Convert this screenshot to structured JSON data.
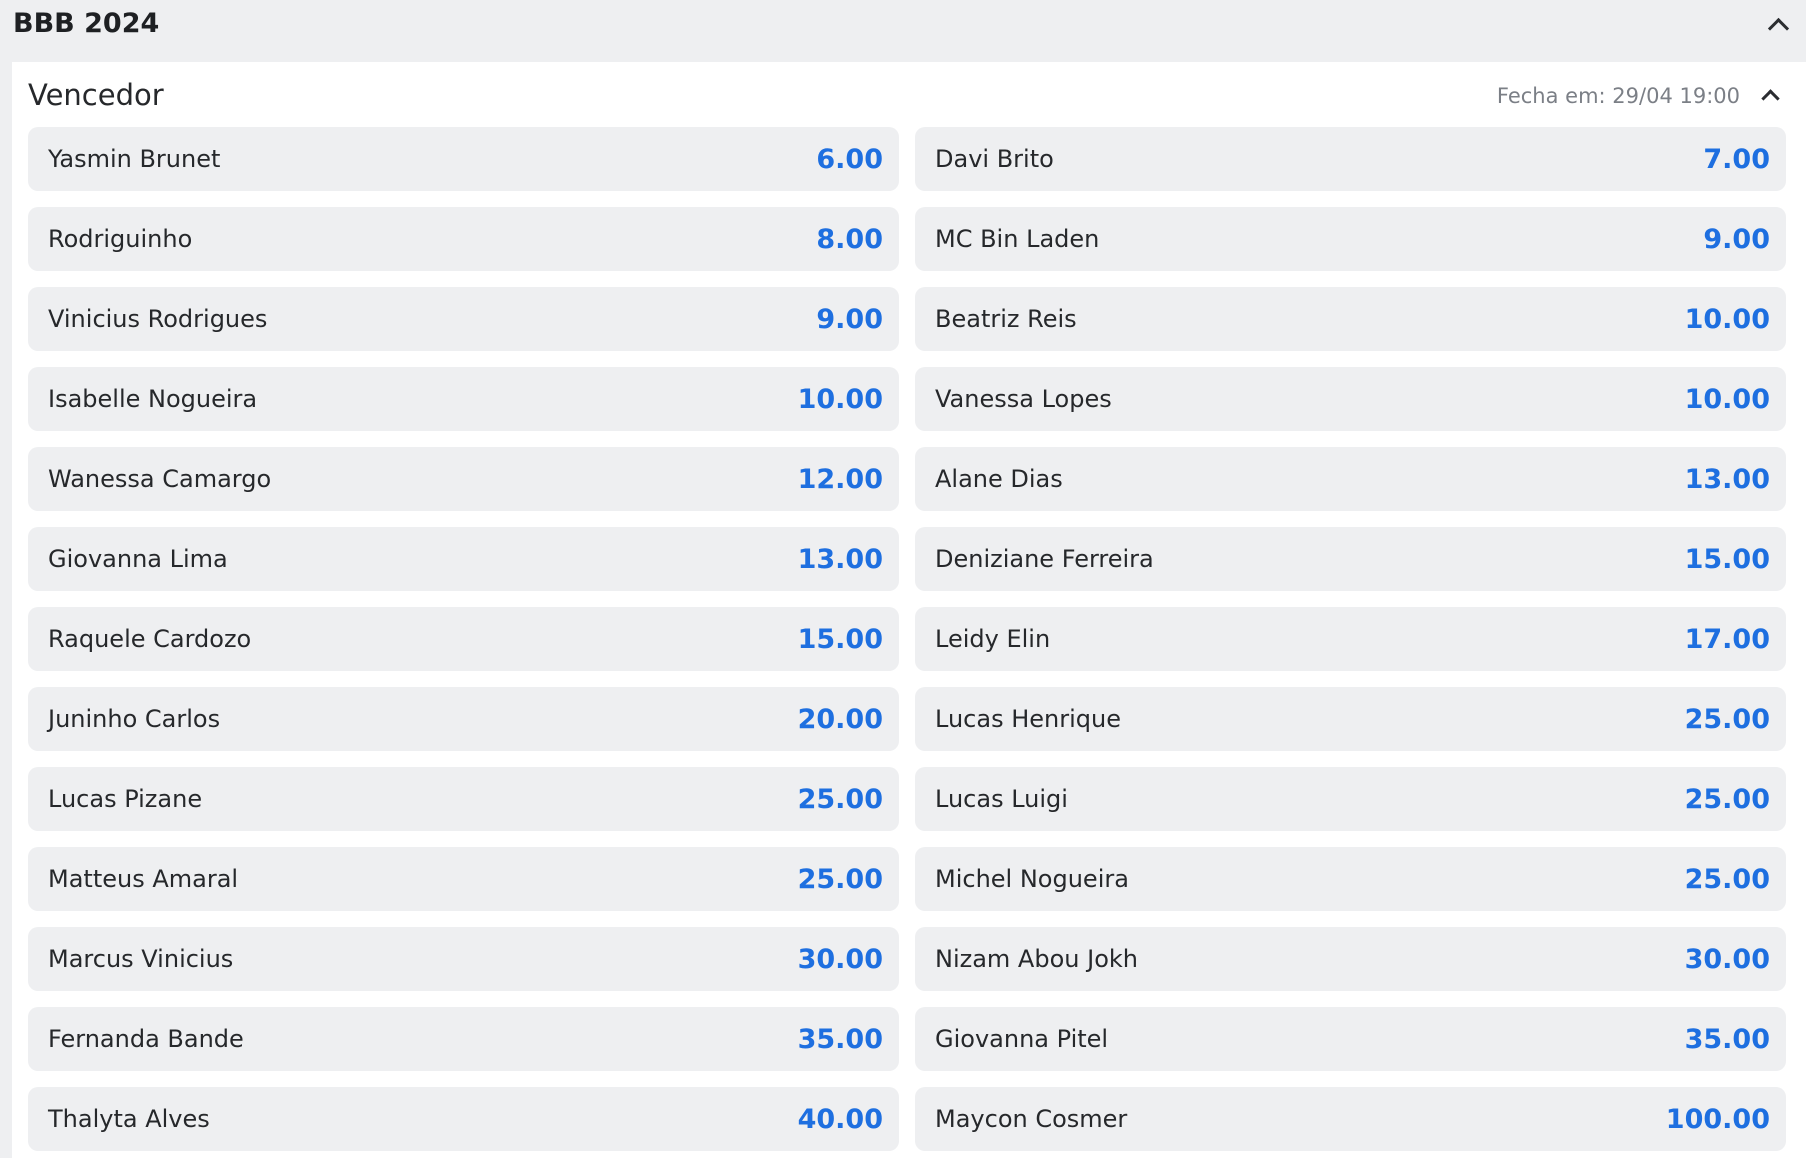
{
  "header": {
    "title": "BBB 2024"
  },
  "market": {
    "title": "Vencedor",
    "closes": "Fecha em: 29/04 19:00",
    "outcomes": [
      {
        "name": "Yasmin Brunet",
        "odds": "6.00"
      },
      {
        "name": "Davi Brito",
        "odds": "7.00"
      },
      {
        "name": "Rodriguinho",
        "odds": "8.00"
      },
      {
        "name": "MC Bin Laden",
        "odds": "9.00"
      },
      {
        "name": "Vinicius Rodrigues",
        "odds": "9.00"
      },
      {
        "name": "Beatriz Reis",
        "odds": "10.00"
      },
      {
        "name": "Isabelle Nogueira",
        "odds": "10.00"
      },
      {
        "name": "Vanessa Lopes",
        "odds": "10.00"
      },
      {
        "name": "Wanessa Camargo",
        "odds": "12.00"
      },
      {
        "name": "Alane Dias",
        "odds": "13.00"
      },
      {
        "name": "Giovanna Lima",
        "odds": "13.00"
      },
      {
        "name": "Deniziane Ferreira",
        "odds": "15.00"
      },
      {
        "name": "Raquele Cardozo",
        "odds": "15.00"
      },
      {
        "name": "Leidy Elin",
        "odds": "17.00"
      },
      {
        "name": "Juninho Carlos",
        "odds": "20.00"
      },
      {
        "name": "Lucas Henrique",
        "odds": "25.00"
      },
      {
        "name": "Lucas Pizane",
        "odds": "25.00"
      },
      {
        "name": "Lucas Luigi",
        "odds": "25.00"
      },
      {
        "name": "Matteus Amaral",
        "odds": "25.00"
      },
      {
        "name": "Michel Nogueira",
        "odds": "25.00"
      },
      {
        "name": "Marcus Vinicius",
        "odds": "30.00"
      },
      {
        "name": "Nizam Abou Jokh",
        "odds": "30.00"
      },
      {
        "name": "Fernanda Bande",
        "odds": "35.00"
      },
      {
        "name": "Giovanna Pitel",
        "odds": "35.00"
      },
      {
        "name": "Thalyta Alves",
        "odds": "40.00"
      },
      {
        "name": "Maycon Cosmer",
        "odds": "100.00"
      }
    ]
  },
  "icons": {
    "collapse": "chevron-up-icon"
  },
  "colors": {
    "odds": "#1e6fe0",
    "outcome_bg": "#eeeff1",
    "page_bg": "#eeeff1",
    "panel_bg": "#ffffff"
  }
}
